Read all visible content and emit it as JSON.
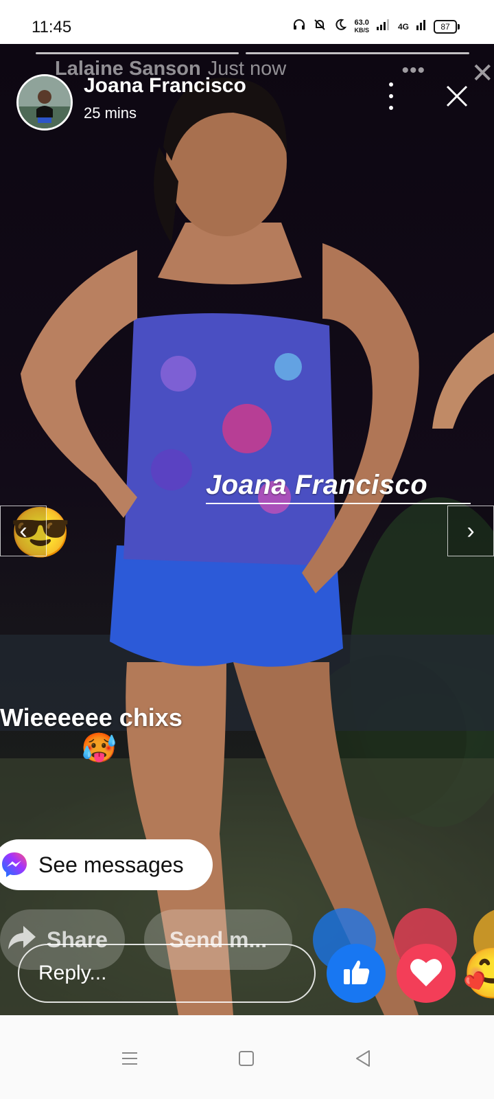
{
  "status_bar": {
    "time": "11:45",
    "net_speed_value": "63.0",
    "net_speed_unit": "KB/S",
    "network_type": "4G",
    "battery": "87"
  },
  "background_story": {
    "author": "Lalaine Sanson",
    "time": "Just now",
    "more": "•••",
    "close": "✕"
  },
  "story": {
    "author": "Joana Francisco",
    "time": "25 mins",
    "caption_name": "Joana Francisco",
    "caption_text": "Wieeeeee chixs",
    "emoji_sunglasses": "😎",
    "emoji_hot": "🥵",
    "prev_arrow": "‹",
    "next_arrow": "›"
  },
  "actions": {
    "see_messages": "See messages",
    "share": "Share",
    "send_message": "Send m...",
    "reply_placeholder": "Reply...",
    "care_emoji": "🥰"
  },
  "colors": {
    "like_blue": "#1877f2",
    "love_red": "#f33e58",
    "status_bg": "#ffffff",
    "nav_bg": "#fafafa"
  }
}
